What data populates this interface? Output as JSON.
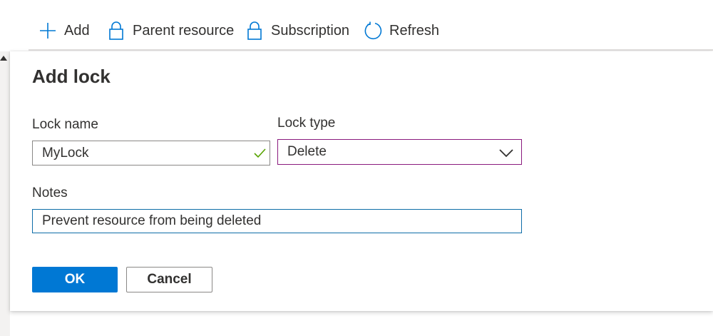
{
  "toolbar": {
    "add_label": "Add",
    "parent_resource_label": "Parent resource",
    "subscription_label": "Subscription",
    "refresh_label": "Refresh"
  },
  "dialog": {
    "title": "Add lock",
    "lock_name_label": "Lock name",
    "lock_name_value": "MyLock",
    "lock_type_label": "Lock type",
    "lock_type_value": "Delete",
    "notes_label": "Notes",
    "notes_value": "Prevent resource from being deleted",
    "ok_label": "OK",
    "cancel_label": "Cancel"
  },
  "icons": {
    "add": "plus-icon",
    "parent_resource": "lock-icon",
    "subscription": "lock-icon",
    "refresh": "refresh-icon",
    "valid": "checkmark-icon",
    "dropdown": "chevron-down-icon"
  },
  "colors": {
    "primary": "#0078d4",
    "icon_blue": "#0078d4",
    "valid_check": "#57a300",
    "select_border": "#8a1a7e",
    "notes_border": "#0e6da8",
    "text": "#323130"
  }
}
